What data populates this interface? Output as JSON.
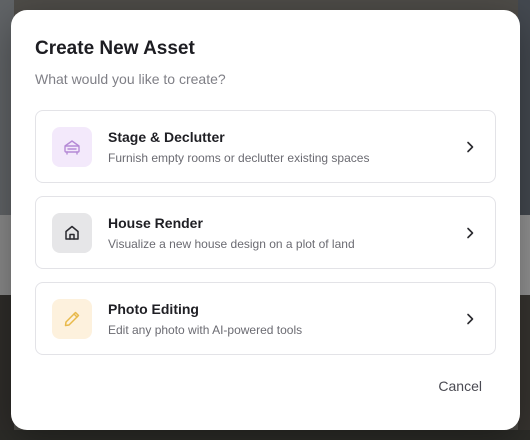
{
  "dialog": {
    "title": "Create New Asset",
    "subtitle": "What would you like to create?",
    "cancel_label": "Cancel"
  },
  "options": [
    {
      "title": "Stage & Declutter",
      "description": "Furnish empty rooms or declutter existing spaces",
      "icon": "sofa-icon",
      "icon_color": "#b58ad6",
      "icon_bg": "#f3e9fb"
    },
    {
      "title": "House Render",
      "description": "Visualize a new house design on a plot of land",
      "icon": "house-icon",
      "icon_color": "#2a2a30",
      "icon_bg": "#e6e6e8"
    },
    {
      "title": "Photo Editing",
      "description": "Edit any photo with AI-powered tools",
      "icon": "pencil-icon",
      "icon_color": "#e8b94a",
      "icon_bg": "#fdf1dd"
    }
  ],
  "colors": {
    "overlay": "#5b5a57",
    "dialog_bg": "#ffffff",
    "border": "#e3e3e7",
    "title_text": "#1d1d22",
    "muted_text": "#7f7f86"
  }
}
